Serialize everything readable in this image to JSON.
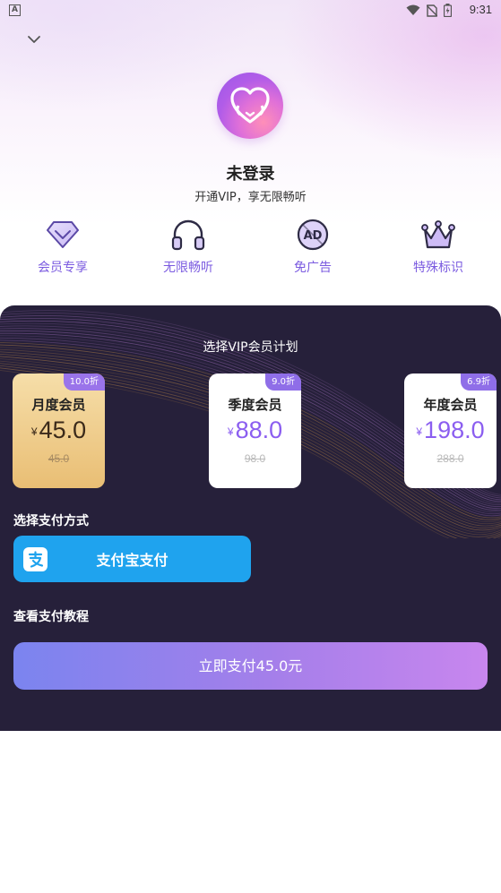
{
  "status_bar": {
    "time": "9:31",
    "notification_letter": "A"
  },
  "header": {
    "user_name": "未登录",
    "subtitle": "开通VIP，享无限畅听"
  },
  "perks": [
    {
      "label": "会员专享",
      "icon": "diamond-icon"
    },
    {
      "label": "无限畅听",
      "icon": "headphones-icon"
    },
    {
      "label": "免广告",
      "icon": "no-ads-icon"
    },
    {
      "label": "特殊标识",
      "icon": "crown-icon"
    }
  ],
  "plan_section": {
    "title": "选择VIP会员计划",
    "currency": "¥",
    "plans": [
      {
        "name": "月度会员",
        "discount": "10.0折",
        "price": "45.0",
        "original": "45.0",
        "selected": true
      },
      {
        "name": "季度会员",
        "discount": "9.0折",
        "price": "88.0",
        "original": "98.0",
        "selected": false
      },
      {
        "name": "年度会员",
        "discount": "6.9折",
        "price": "198.0",
        "original": "288.0",
        "selected": false
      }
    ]
  },
  "payment": {
    "label": "选择支付方式",
    "alipay_label": "支付宝支付",
    "tutorial_label": "查看支付教程"
  },
  "pay_now": {
    "label": "立即支付45.0元"
  },
  "colors": {
    "accent": "#8b5ef0",
    "panel_bg": "#26203a",
    "alipay": "#1fa3ee",
    "selected_card": "#e9be74"
  }
}
